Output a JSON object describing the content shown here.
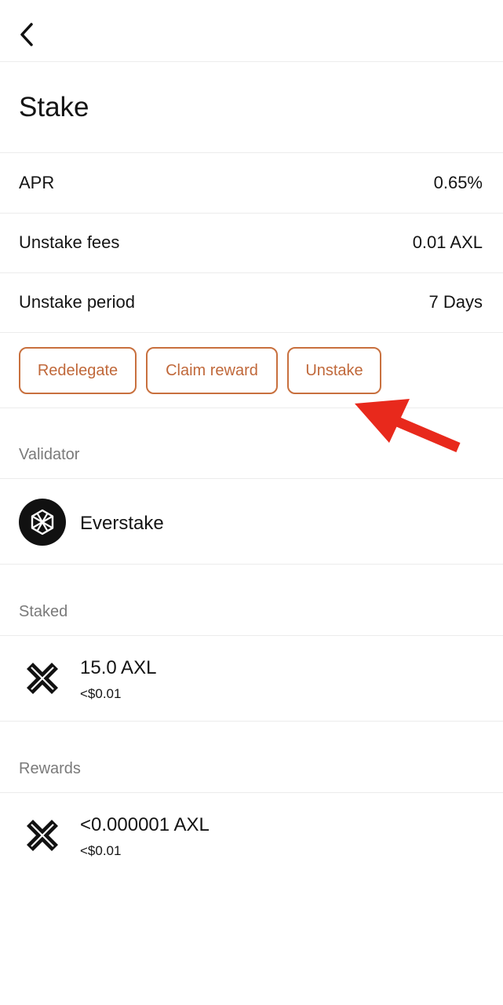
{
  "page": {
    "title": "Stake"
  },
  "info": [
    {
      "label": "APR",
      "value": "0.65%"
    },
    {
      "label": "Unstake fees",
      "value": "0.01 AXL"
    },
    {
      "label": "Unstake period",
      "value": "7 Days"
    }
  ],
  "actions": {
    "redelegate": "Redelegate",
    "claim_reward": "Claim reward",
    "unstake": "Unstake"
  },
  "validator": {
    "section_label": "Validator",
    "name": "Everstake"
  },
  "staked": {
    "section_label": "Staked",
    "amount": "15.0 AXL",
    "fiat": "<$0.01"
  },
  "rewards": {
    "section_label": "Rewards",
    "amount": "<0.000001 AXL",
    "fiat": "<$0.01"
  },
  "colors": {
    "accent": "#c8703e",
    "annotation_arrow": "#e8291c"
  },
  "icons": {
    "back": "chevron-left-icon",
    "validator": "everstake-logo-icon",
    "token": "axelar-logo-icon",
    "annotation": "red-arrow-annotation"
  }
}
